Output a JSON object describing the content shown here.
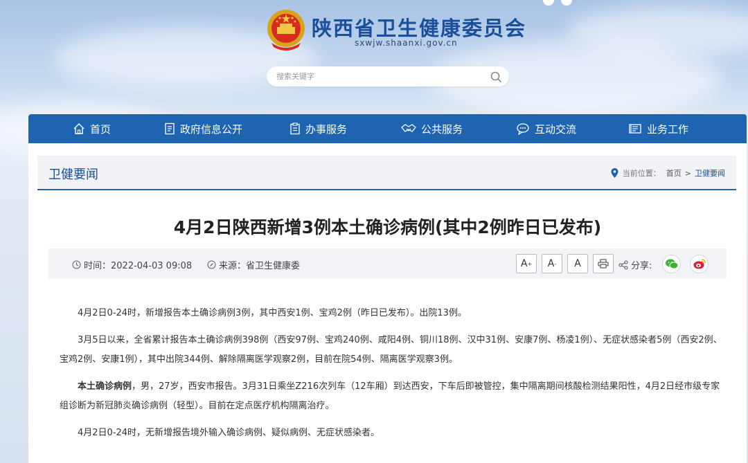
{
  "header": {
    "site_title": "陕西省卫生健康委员会",
    "site_url": "sxwjw.shaanxi.gov.cn",
    "search_placeholder": "搜索关键字"
  },
  "nav": {
    "items": [
      {
        "label": "首页",
        "icon": "home-icon"
      },
      {
        "label": "政府信息公开",
        "icon": "document-icon"
      },
      {
        "label": "办事服务",
        "icon": "clipboard-icon"
      },
      {
        "label": "公共服务",
        "icon": "handshake-icon"
      },
      {
        "label": "互动交流",
        "icon": "chat-icon"
      },
      {
        "label": "业务工作",
        "icon": "book-icon"
      }
    ]
  },
  "section": {
    "title": "卫健要闻",
    "location_label": "当前位置：",
    "crumb_home": "首页",
    "crumb_sep": ">",
    "crumb_current": "卫健要闻"
  },
  "article": {
    "title": "4月2日陕西新增3例本土确诊病例(其中2例昨日已发布)",
    "time_label": "时间：2022-04-03 09:08",
    "source_label": "来源：省卫生健康委",
    "font_large": "A",
    "font_large_sup": "+",
    "font_medium": "A",
    "font_medium_sup": "-",
    "font_reset": "A",
    "share_label": "分享:",
    "p1": "4月2日0-24时，新增报告本土确诊病例3例，其中西安1例、宝鸡2例（昨日已发布）。出院13例。",
    "p2": "3月5日以来，全省累计报告本土确诊病例398例（西安97例、宝鸡240例、咸阳4例、铜川18例、汉中31例、安康7例、杨凌1例）、无症状感染者5例（西安2例、宝鸡2例、安康1例），其中出院344例、解除隔离医学观察2例，目前在院54例、隔离医学观察3例。",
    "p3_bold": "本土确诊病例",
    "p3_rest": "，男，27岁，西安市报告。3月31日乘坐Z216次列车（12车厢）到达西安，下车后即被管控，集中隔离期间核酸检测结果阳性，4月2日经市级专家组诊断为新冠肺炎确诊病例（轻型）。目前在定点医疗机构隔离治疗。",
    "p4": "4月2日0-24时，无新增报告境外输入确诊病例、疑似病例、无症状感染者。"
  },
  "colors": {
    "brand_blue": "#1e64b1",
    "title_blue": "#1a4f99",
    "wechat_green": "#3cb035",
    "weibo_red": "#e6162d"
  }
}
